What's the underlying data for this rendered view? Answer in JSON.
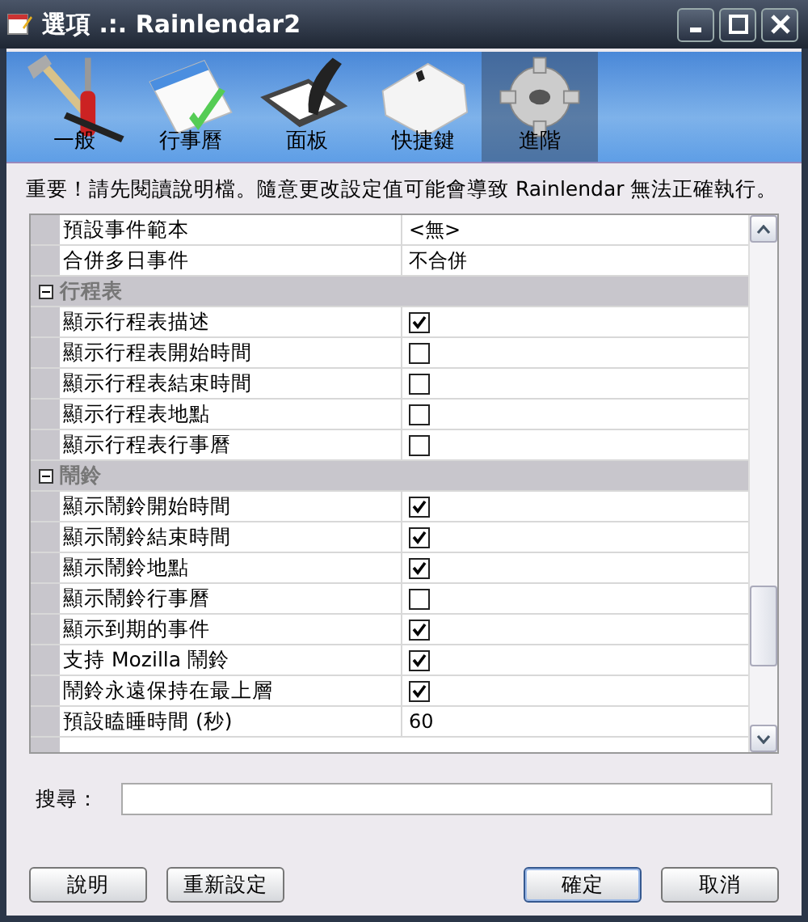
{
  "window": {
    "title": "選項 .:. Rainlendar2"
  },
  "tabs": [
    {
      "label": "一般",
      "kind": "tools",
      "selected": false
    },
    {
      "label": "行事曆",
      "kind": "calendar",
      "selected": false
    },
    {
      "label": "面板",
      "kind": "panel",
      "selected": false
    },
    {
      "label": "快捷鍵",
      "kind": "key",
      "selected": false
    },
    {
      "label": "進階",
      "kind": "gear",
      "selected": true
    }
  ],
  "notice": "重要！請先閱讀說明檔。隨意更改設定值可能會導致 Rainlendar 無法正確執行。",
  "rows": [
    {
      "kind": "text",
      "label": "預設事件範本",
      "value": "<無>"
    },
    {
      "kind": "text",
      "label": "合併多日事件",
      "value": "不合併"
    },
    {
      "kind": "group",
      "label": "行程表",
      "expanded": true
    },
    {
      "kind": "check",
      "label": "顯示行程表描述",
      "checked": true
    },
    {
      "kind": "check",
      "label": "顯示行程表開始時間",
      "checked": false
    },
    {
      "kind": "check",
      "label": "顯示行程表結束時間",
      "checked": false
    },
    {
      "kind": "check",
      "label": "顯示行程表地點",
      "checked": false
    },
    {
      "kind": "check",
      "label": "顯示行程表行事曆",
      "checked": false
    },
    {
      "kind": "group",
      "label": "鬧鈴",
      "expanded": true
    },
    {
      "kind": "check",
      "label": "顯示鬧鈴開始時間",
      "checked": true
    },
    {
      "kind": "check",
      "label": "顯示鬧鈴結束時間",
      "checked": true
    },
    {
      "kind": "check",
      "label": "顯示鬧鈴地點",
      "checked": true
    },
    {
      "kind": "check",
      "label": "顯示鬧鈴行事曆",
      "checked": false
    },
    {
      "kind": "check",
      "label": "顯示到期的事件",
      "checked": true
    },
    {
      "kind": "check",
      "label": "支持 Mozilla 鬧鈴",
      "checked": true
    },
    {
      "kind": "check",
      "label": "鬧鈴永遠保持在最上層",
      "checked": true
    },
    {
      "kind": "text",
      "label": "預設瞌睡時間 (秒)",
      "value": "60"
    }
  ],
  "search": {
    "label": "搜尋："
  },
  "buttons": [
    {
      "label": "說明",
      "default": false
    },
    {
      "label": "重新設定",
      "default": false
    },
    {
      "label": "確定",
      "default": true
    },
    {
      "label": "取消",
      "default": false
    }
  ]
}
